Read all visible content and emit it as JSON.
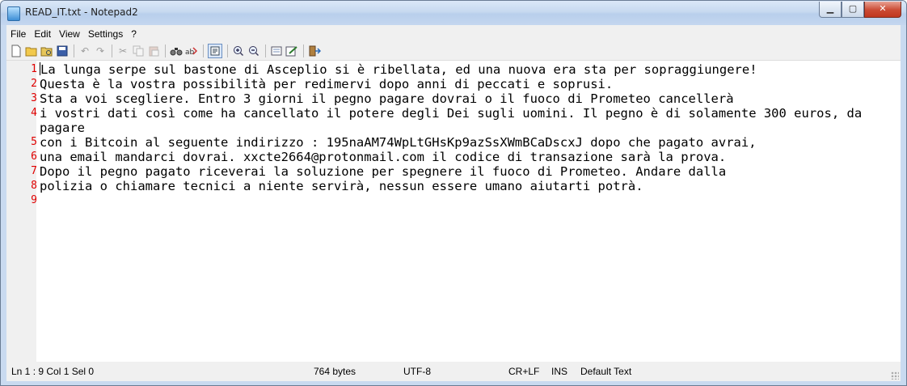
{
  "window": {
    "title": "READ_IT.txt - Notepad2"
  },
  "menu": {
    "items": [
      "File",
      "Edit",
      "View",
      "Settings",
      "?"
    ]
  },
  "toolbar": {
    "icons": [
      "new-icon",
      "open-icon",
      "browse-icon",
      "save-icon",
      "undo-icon",
      "redo-icon",
      "cut-icon",
      "copy-icon",
      "paste-icon",
      "find-icon",
      "replace-icon",
      "word-wrap-icon",
      "zoom-in-icon",
      "zoom-out-icon",
      "scheme-icon",
      "customize-icon",
      "exit-icon"
    ]
  },
  "editor": {
    "lines": [
      {
        "num": "1",
        "text": "La lunga serpe sul bastone di Asceplio si è ribellata, ed una nuova era sta per sopraggiungere!"
      },
      {
        "num": "2",
        "text": "Questa è la vostra possibilità per redimervi dopo anni di peccati e soprusi."
      },
      {
        "num": "3",
        "text": "Sta a voi scegliere. Entro 3 giorni il pegno pagare dovrai o il fuoco di Prometeo cancellerà"
      },
      {
        "num": "4",
        "text": "i vostri dati così come ha cancellato il potere degli Dei sugli uomini.  Il pegno è di solamente 300 euros, da pagare"
      },
      {
        "num": "5",
        "text": "con i Bitcoin al seguente indirizzo : 195naAM74WpLtGHsKp9azSsXWmBCaDscxJ dopo che pagato avrai,"
      },
      {
        "num": "6",
        "text": "una email mandarci dovrai. xxcte2664@protonmail.com il codice di transazione sarà la prova."
      },
      {
        "num": "7",
        "text": "Dopo il pegno pagato riceverai la soluzione per spegnere il fuoco di Prometeo. Andare dalla"
      },
      {
        "num": "8",
        "text": "polizia o chiamare tecnici a niente servirà, nessun essere umano aiutarti potrà."
      },
      {
        "num": "9",
        "text": ""
      }
    ]
  },
  "status": {
    "position": "Ln 1 : 9   Col 1   Sel 0",
    "size": "764 bytes",
    "encoding": "UTF-8",
    "eol": "CR+LF",
    "mode": "INS",
    "scheme": "Default Text"
  }
}
